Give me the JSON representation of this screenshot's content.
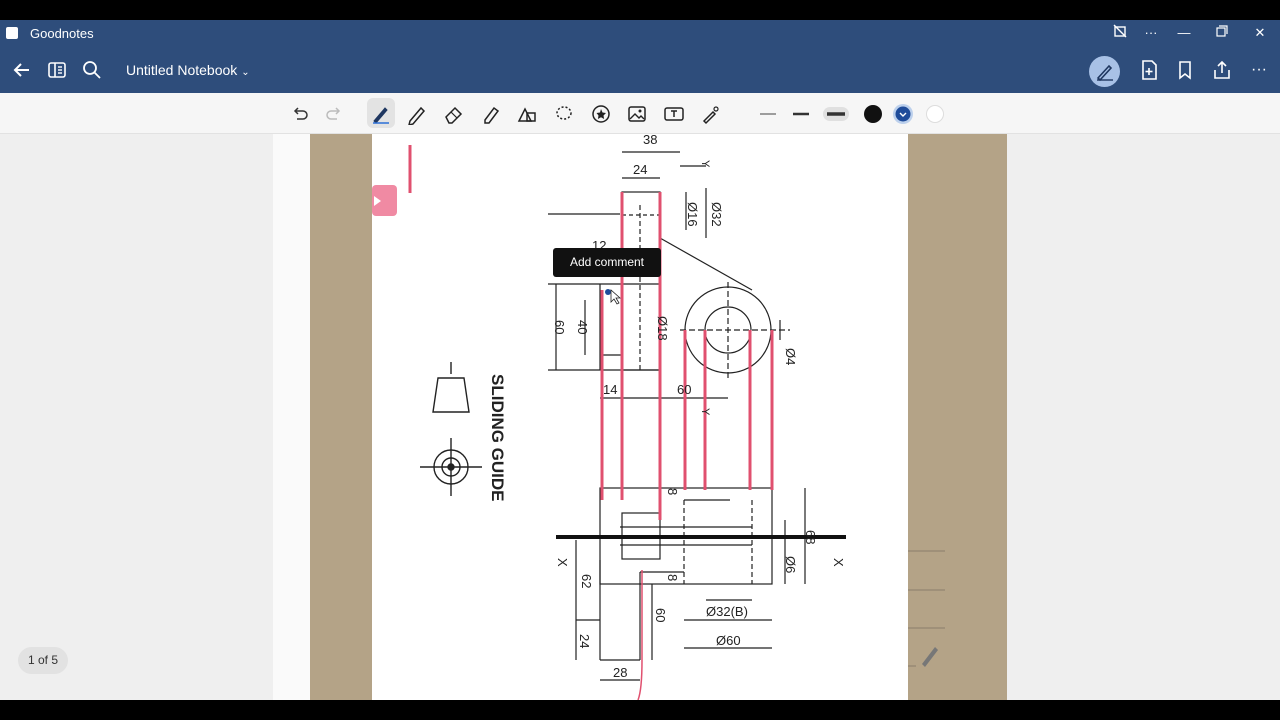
{
  "app": {
    "name": "Goodnotes"
  },
  "notebook": {
    "title": "Untitled Notebook"
  },
  "tooltip": {
    "text": "Add comment"
  },
  "page_indicator": "1 of 5",
  "drawing": {
    "title": "SLIDING GUIDE",
    "dims": {
      "d38": "38",
      "d24top": "24",
      "d12": "12",
      "d016": "Ø16",
      "d032": "Ø32",
      "d60l": "60",
      "d40": "40",
      "d018": "Ø18",
      "d04": "Ø4",
      "d14": "14",
      "d60m": "60",
      "d8a": "8",
      "d68": "68",
      "d06": "Ø6",
      "d8b": "8",
      "d62": "62",
      "d24b": "24",
      "d60b": "60",
      "d032b": "Ø32(B)",
      "d060": "Ø60",
      "d28": "28",
      "xl": "X",
      "xr": "X",
      "y1": "Y",
      "y2": "Y"
    }
  },
  "colors": {
    "chrome": "#2e4d7b",
    "pen_pink": "#e0506f",
    "background_page": "#b4a387"
  }
}
